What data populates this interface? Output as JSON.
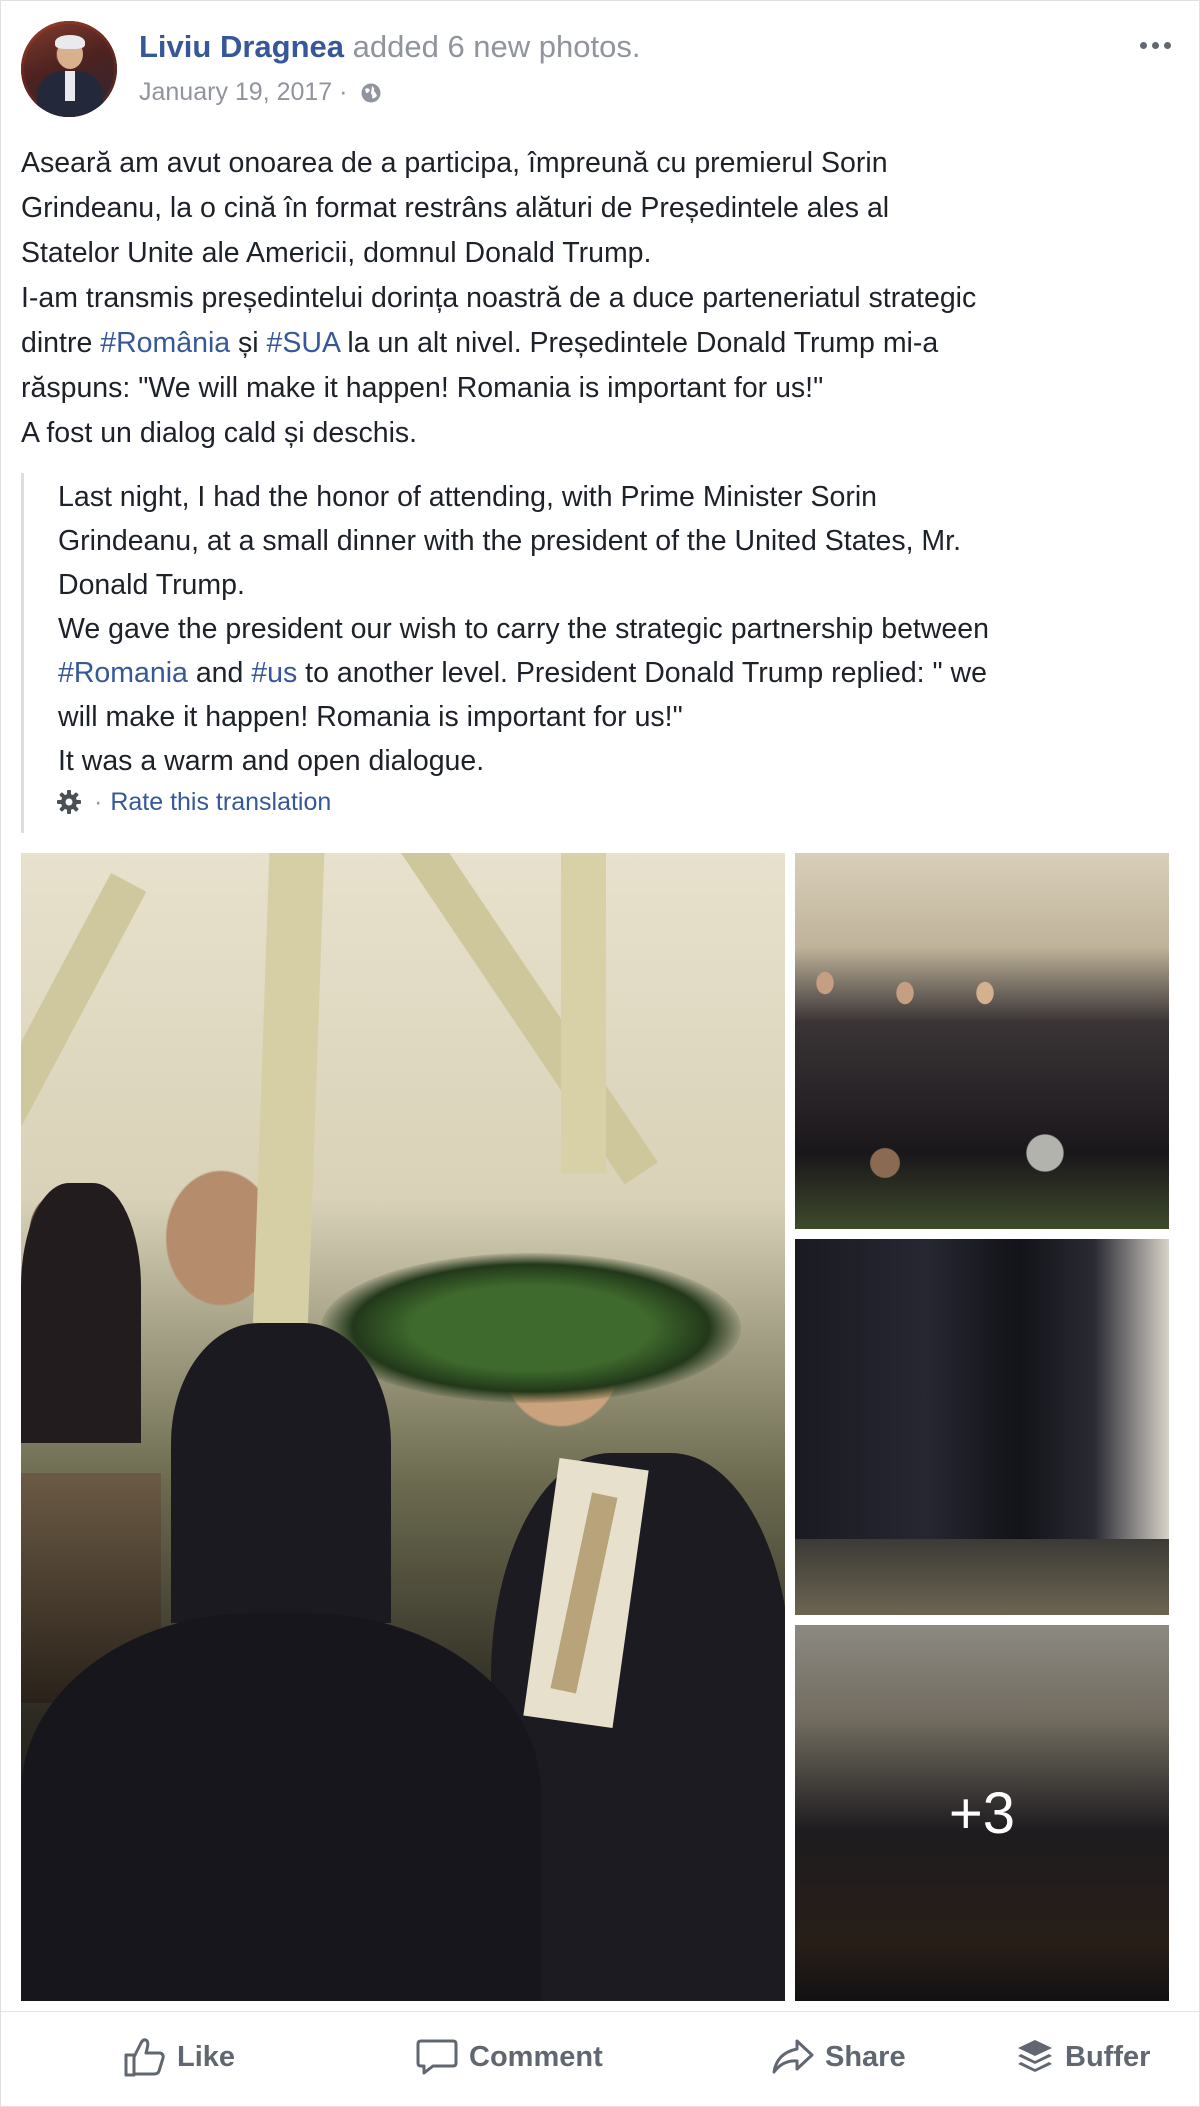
{
  "post": {
    "author": "Liviu Dragnea",
    "action": "added 6 new photos.",
    "date": "January 19, 2017",
    "separator": "·"
  },
  "text": {
    "l1": "Aseară am avut onoarea de a participa, împreună cu premierul Sorin",
    "l2": "Grindeanu, la o cină în format restrâns alături de Președintele ales al",
    "l3": "Statelor Unite ale Americii, domnul Donald Trump.",
    "l4": "I-am transmis președintelui dorința noastră de a duce parteneriatul strategic",
    "l5_a": "dintre ",
    "l5_tag1": "#România",
    "l5_b": " și ",
    "l5_tag2": "#SUA",
    "l5_c": " la un alt nivel. Președintele Donald Trump mi-a",
    "l6": "răspuns: \"We will make it happen! Romania is important for us!\"",
    "l7": "A fost un dialog cald și deschis."
  },
  "translation": {
    "l1": "Last night, I had the honor of attending, with Prime Minister Sorin",
    "l2": "Grindeanu, at a small dinner with the president of the United States, Mr.",
    "l3": "Donald Trump.",
    "l4": "We gave the president our wish to carry the strategic partnership between",
    "l5_tag1": "#Romania",
    "l5_a": " and ",
    "l5_tag2": "#us",
    "l5_b": " to another level. President Donald Trump replied: \" we",
    "l6": "will make it happen! Romania is important for us!\"",
    "l7": "It was a warm and open dialogue.",
    "rate_sep": "·",
    "rate_label": "Rate this translation"
  },
  "photos": {
    "more_count": "+3"
  },
  "actions": {
    "like": "Like",
    "comment": "Comment",
    "share": "Share",
    "buffer": "Buffer"
  },
  "colors": {
    "link": "#365899",
    "muted": "#90949c",
    "action_text": "#616770"
  },
  "icons": [
    "more-options-icon",
    "globe-icon",
    "gear-icon",
    "like-icon",
    "comment-icon",
    "share-icon",
    "buffer-icon"
  ]
}
